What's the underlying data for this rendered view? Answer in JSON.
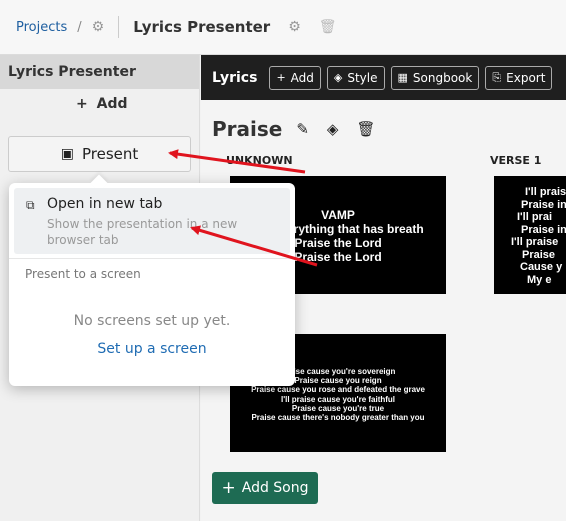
{
  "breadcrumb": {
    "projects": "Projects",
    "separator": "/",
    "project_title": "Lyrics Presenter"
  },
  "icons": {
    "gear": "⚙",
    "trash": "🗑",
    "plus": "+",
    "present": "▣",
    "external_link": "⧉"
  },
  "sidebar": {
    "title": "Lyrics Presenter",
    "add_label": "Add",
    "present_label": "Present"
  },
  "toolbar": {
    "title": "Lyrics",
    "buttons": [
      {
        "icon": "+",
        "label": "Add"
      },
      {
        "icon": "◈",
        "label": "Style"
      },
      {
        "icon": "▦",
        "label": "Songbook"
      },
      {
        "icon": "⎘",
        "label": "Export"
      }
    ]
  },
  "song": {
    "title": "Praise",
    "sections": [
      {
        "label": "UNKNOWN"
      },
      {
        "label": "VERSE 1"
      }
    ],
    "slides": [
      {
        "lines": [
          "VAMP",
          "Let everything that has breath",
          "Praise the Lord",
          "Praise the Lord"
        ]
      },
      {
        "lines": [
          "I'll praise",
          "Praise in",
          "I'll prai",
          "Praise in",
          "I'll praise",
          "Praise",
          "Cause y",
          "My e"
        ]
      },
      {
        "lines": [
          "Praise cause you're sovereign",
          "Praise cause you reign",
          "Praise cause you rose and defeated the grave",
          "I'll praise cause you're faithful",
          "Praise cause you're true",
          "Praise cause there's nobody greater than you"
        ]
      }
    ],
    "add_song_label": "Add Song"
  },
  "popover": {
    "open_new_tab_label": "Open in new tab",
    "open_new_tab_desc": "Show the presentation in a new browser tab",
    "screen_section_label": "Present to a screen",
    "empty_text": "No screens set up yet.",
    "setup_link": "Set up a screen"
  },
  "colors": {
    "toolbar_bg": "#1f1f1f",
    "accent_green": "#1e6b53",
    "link_blue": "#1f6cb3",
    "annotation_red": "#e0141e"
  }
}
